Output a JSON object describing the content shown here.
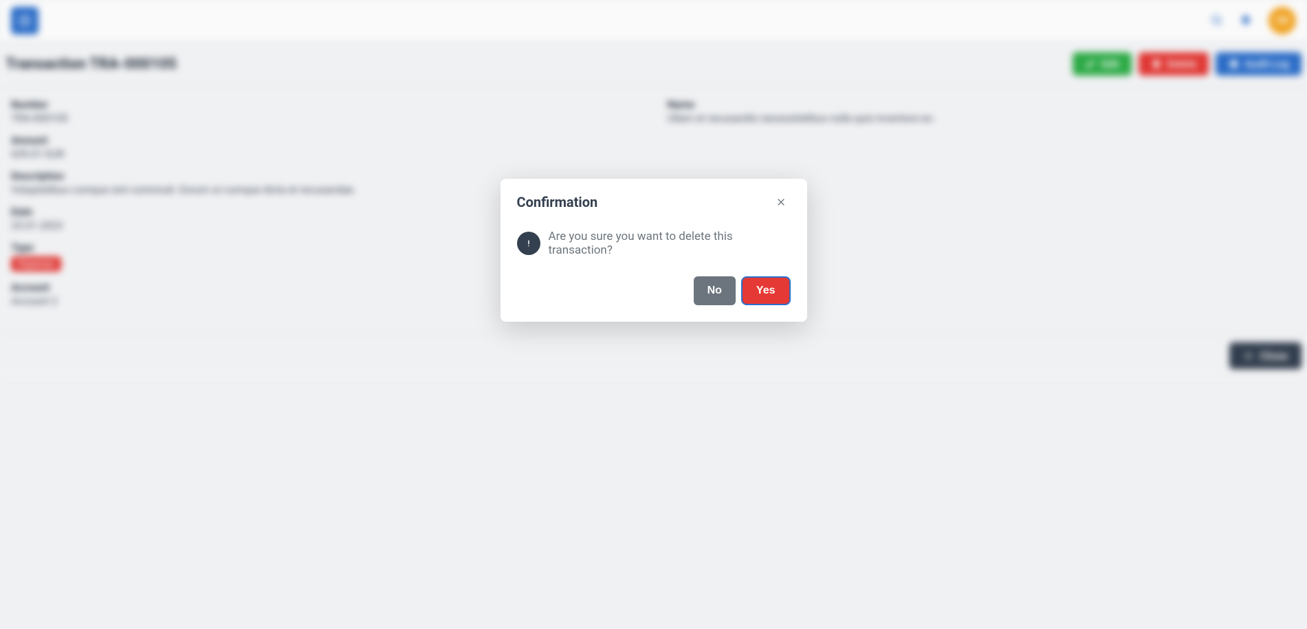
{
  "topbar": {
    "avatar_initials": "GB"
  },
  "page": {
    "title": "Transaction TRA-000105"
  },
  "actions": {
    "edit": "Edit",
    "delete": "Delete",
    "audit_log": "Audit Log",
    "close": "Close"
  },
  "fields": {
    "number": {
      "label": "Number",
      "value": "TRA-000105"
    },
    "name": {
      "label": "Name",
      "value": "Ullam et recusandis necessitatibus nulla quis inventore eo."
    },
    "amount": {
      "label": "Amount",
      "value": "639.01 EUR"
    },
    "description": {
      "label": "Description",
      "value": "Voluptatibus cumque sint commodi. Eorum ut cumque dicta et recusandae."
    },
    "date": {
      "label": "Date",
      "value": "23.01.2023"
    },
    "type": {
      "label": "Type",
      "value": "Expense"
    },
    "account": {
      "label": "Account",
      "value": "Account 2"
    }
  },
  "dialog": {
    "title": "Confirmation",
    "message": "Are you sure you want to delete this transaction?",
    "no": "No",
    "yes": "Yes"
  }
}
